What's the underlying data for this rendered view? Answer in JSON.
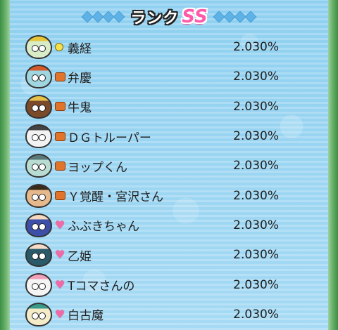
{
  "header": {
    "title": "ランク",
    "rank": "SS"
  },
  "entries": [
    {
      "name": "義経",
      "percent": "2.030%",
      "tribe_icon": "bulb-icon",
      "avatar_color": "#d9ecc8",
      "accent": "#e8c63a"
    },
    {
      "name": "弁慶",
      "percent": "2.030%",
      "tribe_icon": "fist-icon",
      "avatar_color": "#9fd6df",
      "accent": "#d45a2a"
    },
    {
      "name": "牛鬼",
      "percent": "2.030%",
      "tribe_icon": "fist-icon",
      "avatar_color": "#7a4a2a",
      "accent": "#e6c24a"
    },
    {
      "name": "ＤＧトルーパー",
      "percent": "2.030%",
      "tribe_icon": "fist-icon",
      "avatar_color": "#f2f2f2",
      "accent": "#444444"
    },
    {
      "name": "ヨップくん",
      "percent": "2.030%",
      "tribe_icon": "fist-icon",
      "avatar_color": "#b8dcd2",
      "accent": "#5a7a7a"
    },
    {
      "name": "Ｙ覚醒・宮沢さん",
      "percent": "2.030%",
      "tribe_icon": "fist-icon",
      "avatar_color": "#e6b98c",
      "accent": "#3a2a1a"
    },
    {
      "name": "ふぶきちゃん",
      "percent": "2.030%",
      "tribe_icon": "heart-icon",
      "avatar_color": "#3d4fa8",
      "accent": "#f4d8c0"
    },
    {
      "name": "乙姫",
      "percent": "2.030%",
      "tribe_icon": "heart-icon",
      "avatar_color": "#2a5a6a",
      "accent": "#f4dcc8"
    },
    {
      "name": "Tコマさんの",
      "percent": "2.030%",
      "tribe_icon": "heart-icon",
      "avatar_color": "#f4f4f4",
      "accent": "#f0a0b8"
    },
    {
      "name": "白古魔",
      "percent": "2.030%",
      "tribe_icon": "heart-icon",
      "avatar_color": "#f4ecc8",
      "accent": "#3a9a8a"
    }
  ]
}
